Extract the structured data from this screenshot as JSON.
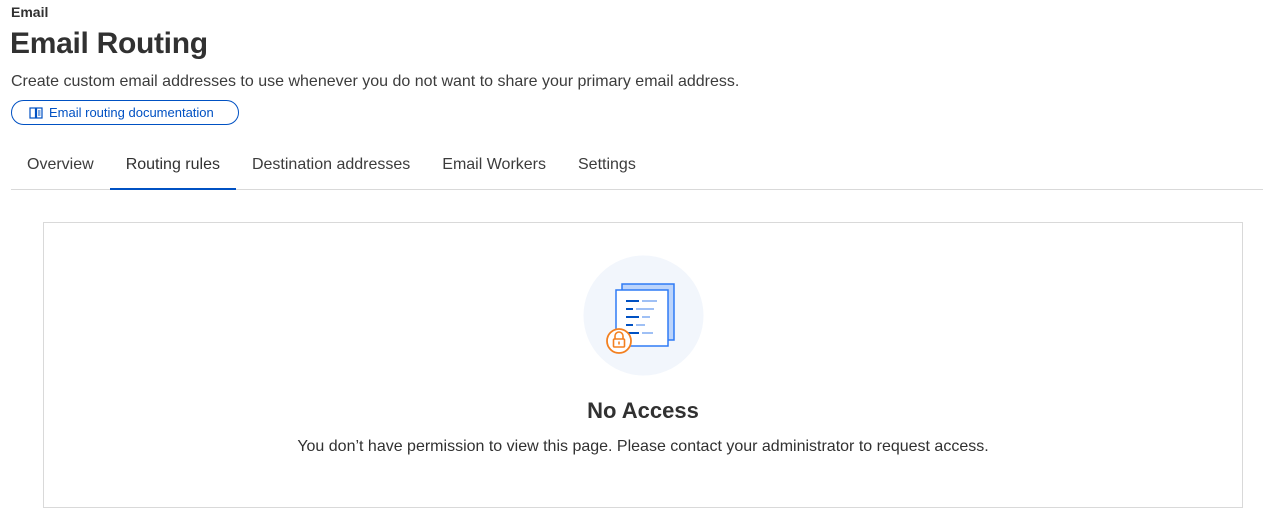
{
  "header": {
    "breadcrumb": "Email",
    "title": "Email Routing",
    "description": "Create custom email addresses to use whenever you do not want to share your primary email address.",
    "doc_link": {
      "label": "Email routing documentation",
      "icon": "book-icon"
    }
  },
  "tabs": [
    {
      "label": "Overview",
      "active": false
    },
    {
      "label": "Routing rules",
      "active": true
    },
    {
      "label": "Destination addresses",
      "active": false
    },
    {
      "label": "Email Workers",
      "active": false
    },
    {
      "label": "Settings",
      "active": false
    }
  ],
  "no_access": {
    "title": "No Access",
    "message": "You don’t have permission to view this page. Please contact your administrator to request access.",
    "illustration_icon": "locked-document-icon"
  },
  "colors": {
    "accent": "#0051c3",
    "border": "#d9d9d9",
    "lock": "#f38020",
    "illustration_bg": "#f2f6fc"
  }
}
